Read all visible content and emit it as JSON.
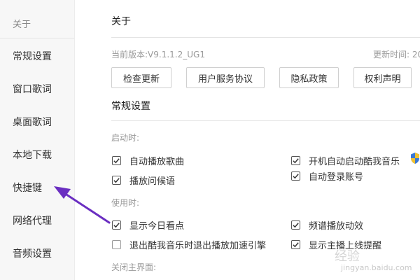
{
  "sidebar": {
    "items": [
      {
        "label": "关于"
      },
      {
        "label": "常规设置"
      },
      {
        "label": "窗口歌词"
      },
      {
        "label": "桌面歌词"
      },
      {
        "label": "本地下载"
      },
      {
        "label": "快捷键"
      },
      {
        "label": "网络代理"
      },
      {
        "label": "音频设置"
      }
    ]
  },
  "about": {
    "title": "关于",
    "version": "当前版本:V9.1.1.2_UG1",
    "update_time": "更新时间: 20",
    "buttons": [
      "检查更新",
      "用户服务协议",
      "隐私政策",
      "权利声明"
    ]
  },
  "settings": {
    "title": "常规设置",
    "startup_label": "启动时:",
    "startup_options": [
      {
        "label": "自动播放歌曲",
        "checked": true
      },
      {
        "label": "开机自动启动酷我音乐",
        "checked": true
      },
      {
        "label": "播放问候语",
        "checked": true
      },
      {
        "label": "自动登录账号",
        "checked": true
      }
    ],
    "usage_label": "使用时:",
    "usage_options": [
      {
        "label": "显示今日看点",
        "checked": true
      },
      {
        "label": "频谱播放动效",
        "checked": true
      },
      {
        "label": "退出酷我音乐时退出播放加速引擎",
        "checked": false
      },
      {
        "label": "显示主播上线提醒",
        "checked": true
      }
    ],
    "close_label": "关闭主界面:"
  },
  "icons": {
    "shield": "uac-shield-icon",
    "arrow": "annotation-arrow-icon",
    "arrow_color": "#6a2ec1"
  },
  "watermark": {
    "text": "经验",
    "url": "jingyan.baidu.com"
  }
}
